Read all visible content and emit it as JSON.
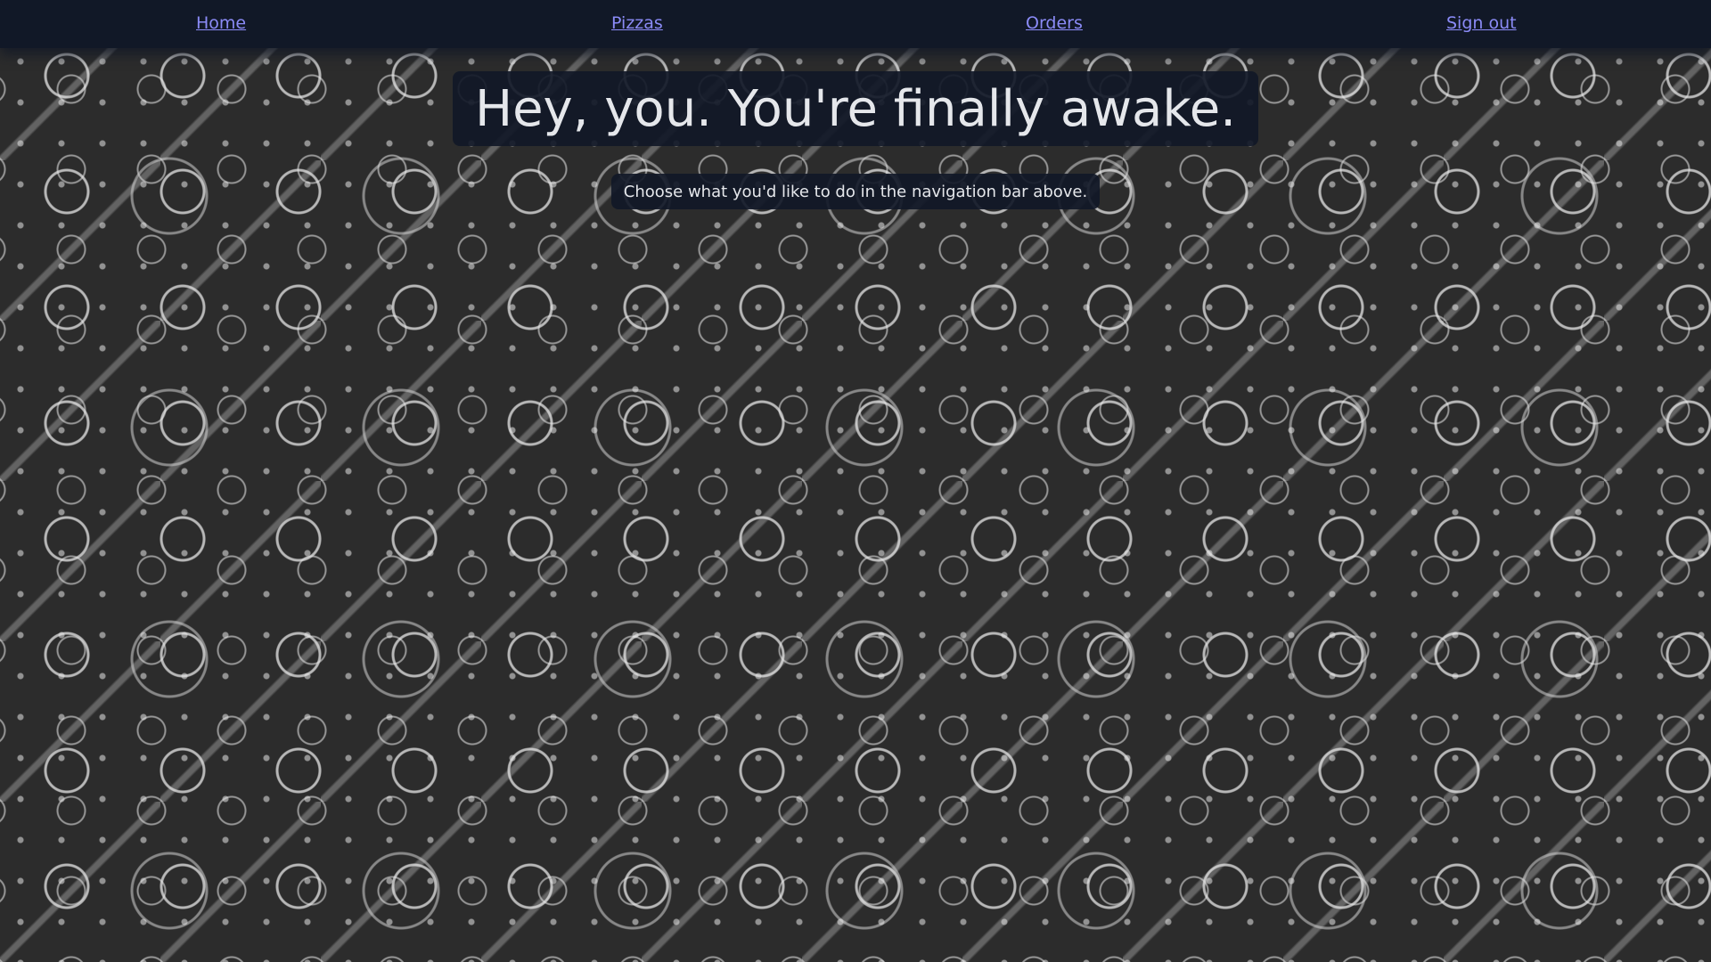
{
  "nav": {
    "items": [
      {
        "label": "Home"
      },
      {
        "label": "Pizzas"
      },
      {
        "label": "Orders"
      },
      {
        "label": "Sign out"
      }
    ]
  },
  "hero": {
    "title": "Hey, you. You're finally awake.",
    "subtitle": "Choose what you'd like to do in the navigation bar above."
  },
  "colors": {
    "navbar_bg": "#111827",
    "link": "#8b8bf7",
    "text": "#e5e7eb",
    "page_bg": "#2c2c2c"
  },
  "background": {
    "pattern": "pizza-ingredients-doodle"
  }
}
